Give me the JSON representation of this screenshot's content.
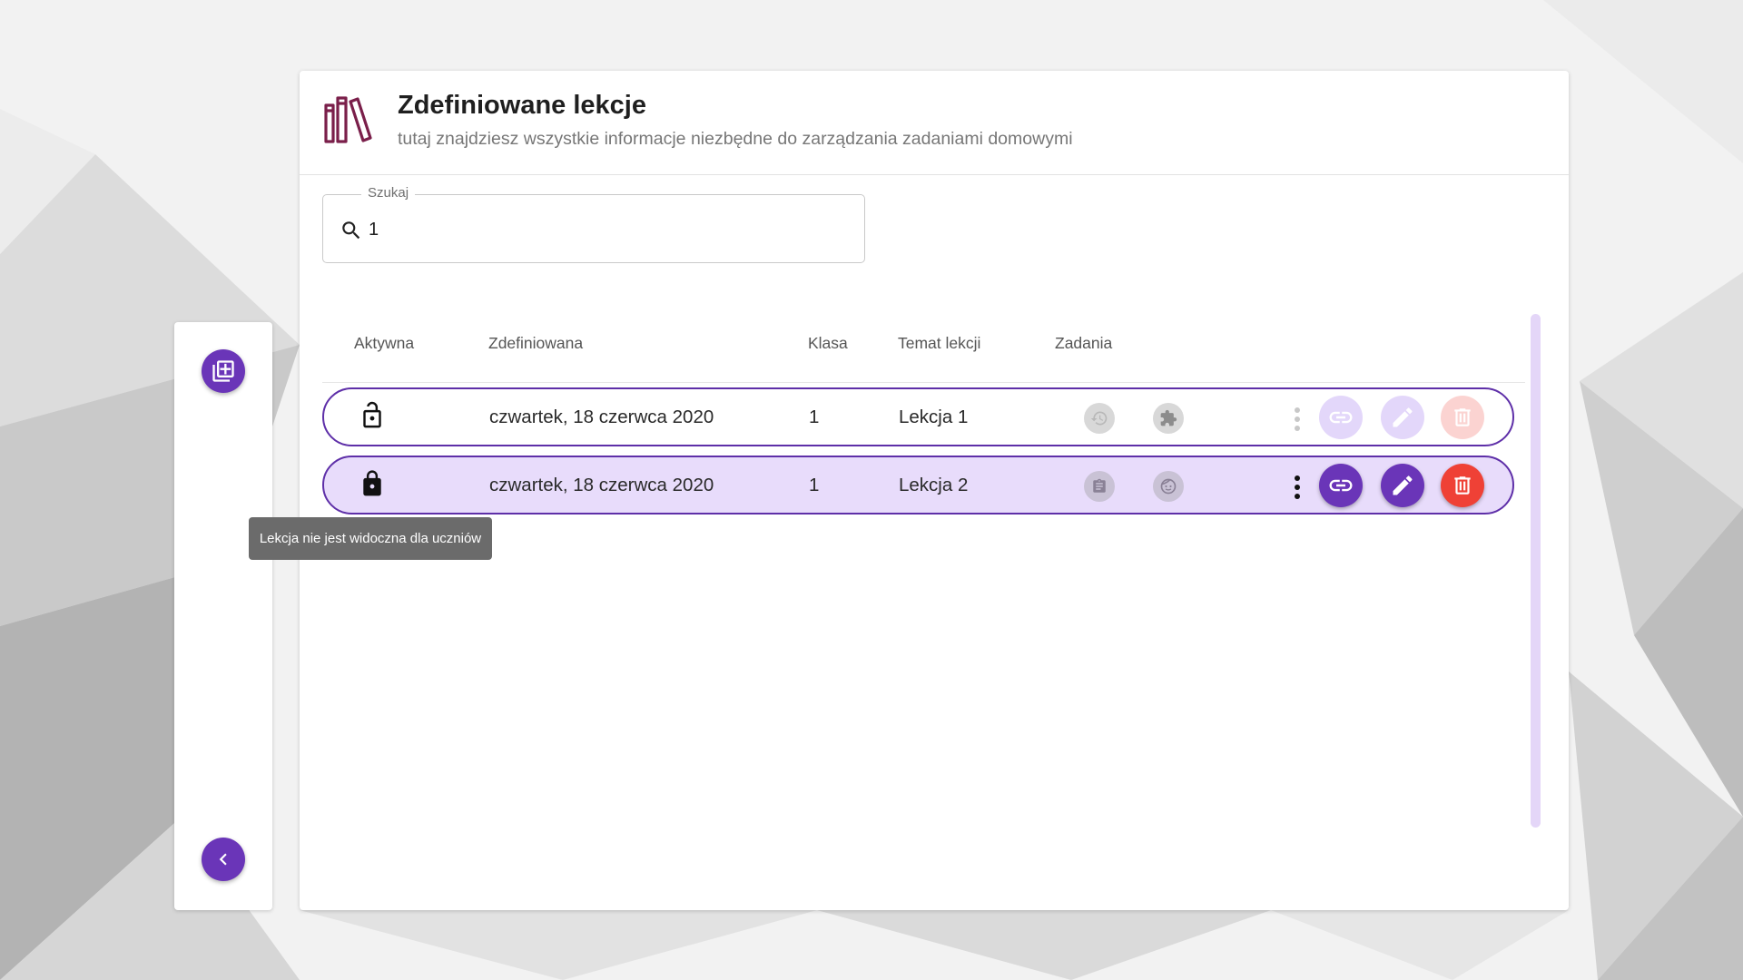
{
  "header": {
    "title": "Zdefiniowane lekcje",
    "subtitle": "tutaj znajdziesz wszystkie informacje niezbędne do zarządzania zadaniami domowymi",
    "icon": "books-icon"
  },
  "search": {
    "label": "Szukaj",
    "value": "1",
    "icon": "search-icon"
  },
  "table": {
    "columns": [
      "Aktywna",
      "Zdefiniowana",
      "Klasa",
      "Temat lekcji",
      "Zadania"
    ],
    "rows": [
      {
        "active_icon": "lock-open-icon",
        "defined": "czwartek, 18 czerwca 2020",
        "class": "1",
        "topic": "Lekcja 1",
        "task_icons": [
          "history-icon",
          "puzzle-icon"
        ],
        "state": "inactive"
      },
      {
        "active_icon": "lock-closed-icon",
        "defined": "czwartek, 18 czerwca 2020",
        "class": "1",
        "topic": "Lekcja 2",
        "task_icons": [
          "clipboard-icon",
          "face-icon"
        ],
        "state": "selected"
      }
    ]
  },
  "tooltip": {
    "text": "Lekcja nie jest widoczna dla uczniów"
  },
  "sidebar": {
    "add_icon": "library-add-icon",
    "back_icon": "chevron-left-icon"
  },
  "colors": {
    "accent": "#6a35b8",
    "danger": "#ef4136",
    "selected_row": "#e8dcfb",
    "header_icon": "#7a1f4a"
  }
}
